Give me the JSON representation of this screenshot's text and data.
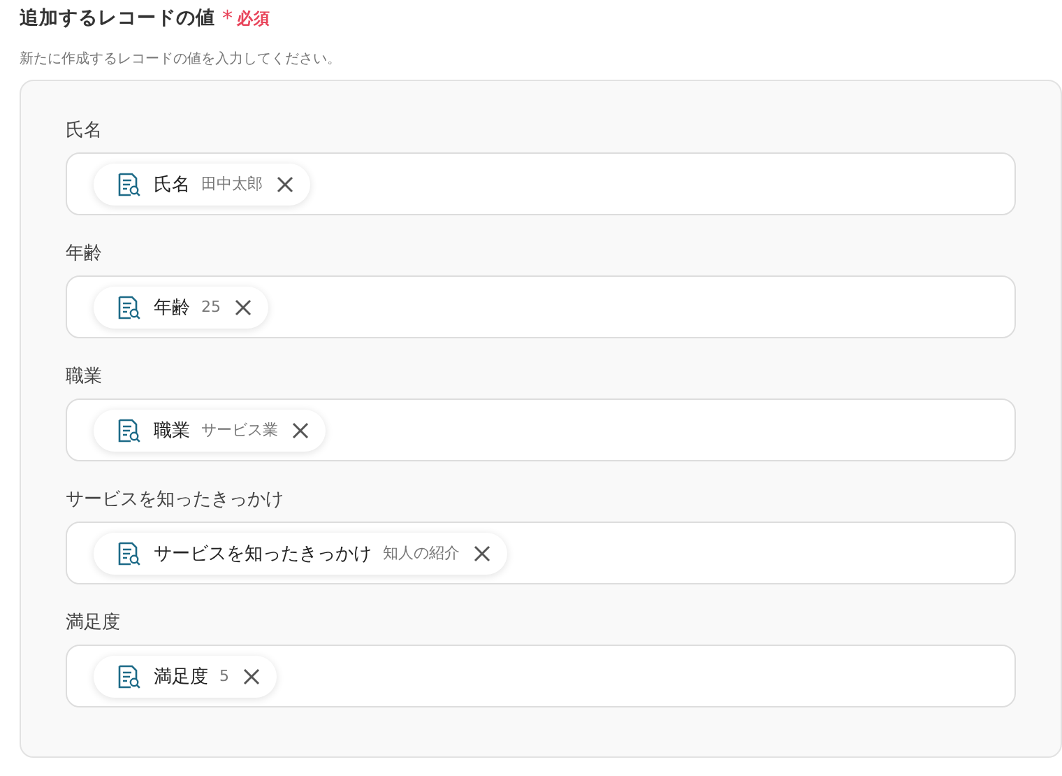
{
  "section": {
    "title": "追加するレコードの値",
    "required_mark": "*",
    "required_label": "必須",
    "description": "新たに作成するレコードの値を入力してください。"
  },
  "fields": [
    {
      "label": "氏名",
      "chip": {
        "name": "氏名",
        "value": "田中太郎"
      }
    },
    {
      "label": "年齢",
      "chip": {
        "name": "年齢",
        "value": "25"
      }
    },
    {
      "label": "職業",
      "chip": {
        "name": "職業",
        "value": "サービス業"
      }
    },
    {
      "label": "サービスを知ったきっかけ",
      "chip": {
        "name": "サービスを知ったきっかけ",
        "value": "知人の紹介"
      }
    },
    {
      "label": "満足度",
      "chip": {
        "name": "満足度",
        "value": "5"
      }
    }
  ]
}
